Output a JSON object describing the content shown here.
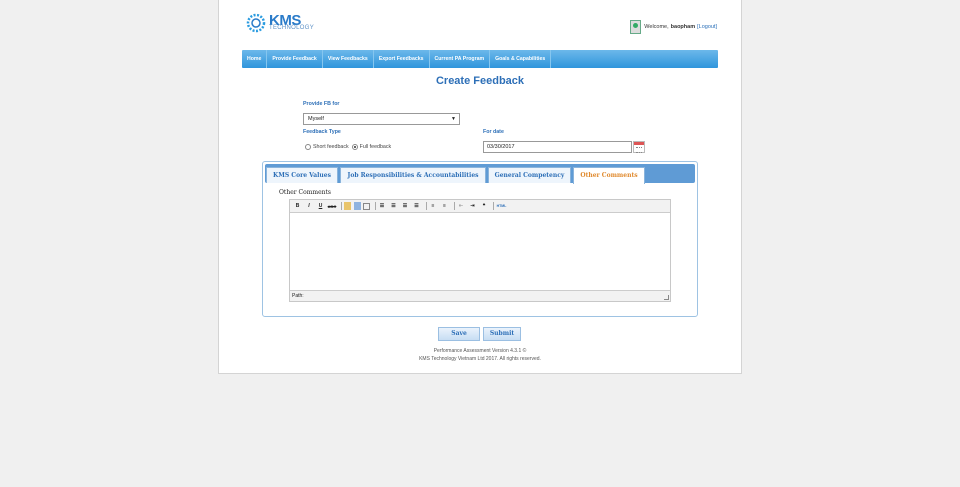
{
  "logo": {
    "name": "KMS",
    "sub": "TECHNOLOGY"
  },
  "user": {
    "welcome": "Welcome,",
    "name": "baopham",
    "logout": "[Logout]"
  },
  "nav": [
    "Home",
    "Provide Feedback",
    "View Feedbacks",
    "Export Feedbacks",
    "Current PA Program",
    "Goals & Capabilities"
  ],
  "page_title": "Create Feedback",
  "form": {
    "provide_for_label": "Provide FB for",
    "provide_for_value": "Myself",
    "feedback_type_label": "Feedback Type",
    "short_label": "Short feedback",
    "full_label": "Full feedback",
    "for_date_label": "For date",
    "for_date_value": "03/30/2017"
  },
  "tabs": [
    "KMS Core Values",
    "Job Responsibilities & Accountabilities",
    "General Competency",
    "Other Comments"
  ],
  "editor": {
    "section_title": "Other Comments",
    "path_label": "Path:"
  },
  "buttons": {
    "save": "Save",
    "submit": "Submit"
  },
  "footer": {
    "line1": "Performance Assessment Version 4.3.1 ©",
    "line2": "KMS Technology Vietnam Ltd 2017. All rights reserved."
  },
  "colors": {
    "accent": "#2d6fb7",
    "nav": "#2f95dc",
    "active_tab": "#e08a2e"
  }
}
